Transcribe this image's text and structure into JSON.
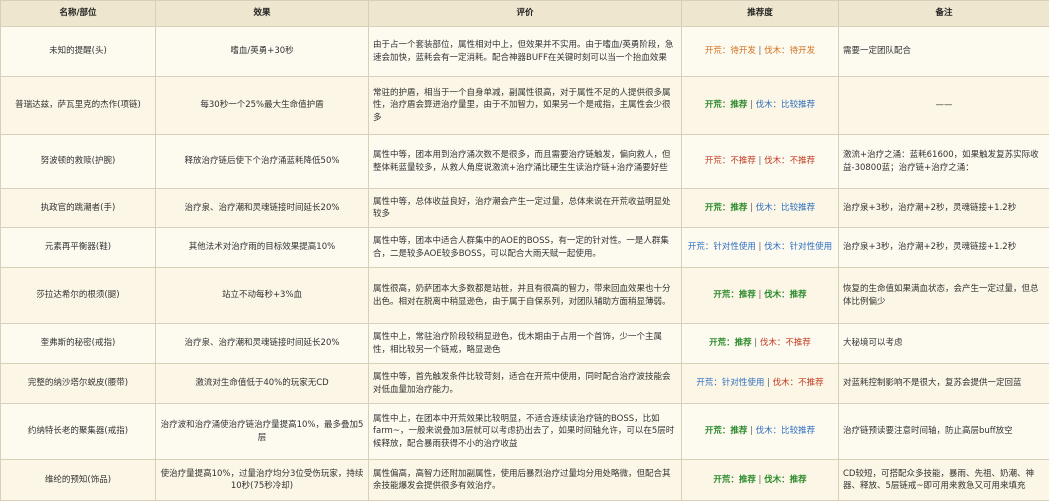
{
  "headers": {
    "name": "名称/部位",
    "effect": "效果",
    "review": "评价",
    "rec": "推荐度",
    "note": "备注"
  },
  "colors": {
    "recommend": "#2e8b2e",
    "notRecommend": "#c23b22",
    "pending": "#d0711d",
    "situational": "#2f6fbf"
  },
  "rows": [
    {
      "name": "未知的提醒(头)",
      "effect": "嗜血/英勇+30秒",
      "review": "由于占一个套装部位，属性相对中上，但效果并不实用。由于嗜血/英勇阶段，急速会加快，蓝耗会有一定消耗。配合神器BUFF在关键时刻可以当一个抬血效果",
      "rec": {
        "a": "开荒：待开发",
        "b": "伐木：待开发"
      },
      "note": "需要一定团队配合"
    },
    {
      "name": "普瑞达兹，萨瓦里克的杰作(项链)",
      "effect": "每30秒一个25%最大生命值护盾",
      "review": "常驻的护盾，相当于一个自身单减，副属性很高，对于属性不足的人提供很多属性，治疗盾会算进治疗量里，由于不加智力，如果另一个是戒指，主属性会少很多",
      "rec": {
        "a": "开荒：推荐",
        "b": "伐木：比较推荐"
      },
      "note": "——"
    },
    {
      "name": "努波顿的救赎(护腕)",
      "effect": "释放治疗链后使下个治疗涌蓝耗降低50%",
      "review": "属性中等，团本用到治疗涌次数不是很多，而且需要治疗链触发，偏向救人，但整体耗蓝量较多，从救人角度说激流+治疗涌比硬生生读治疗链+治疗涌要好些",
      "rec": {
        "a": "开荒：不推荐",
        "b": "伐木：不推荐"
      },
      "note": "激流+治疗之涌：蓝耗61600，如果触发复苏实际收益-30800蓝；治疗链+治疗之涌："
    },
    {
      "name": "执政官的跳潮者(手)",
      "effect": "治疗泉、治疗潮和灵魂链接时间延长20%",
      "review": "属性中等，总体收益良好，治疗潮会产生一定过量，总体来说在开荒收益明显处较多",
      "rec": {
        "a": "开荒：推荐",
        "b": "伐木：比较推荐"
      },
      "note": "治疗泉+3秒，治疗潮+2秒，灵魂链接+1.2秒"
    },
    {
      "name": "元素再平衡器(鞋)",
      "effect": "其他法术对治疗雨的目标效果提高10%",
      "review": "属性中等，团本中适合人群集中的AOE的BOSS，有一定的针对性。一是人群集合，二是较多AOE较多BOSS，可以配合大雨天赋一起使用。",
      "rec": {
        "a": "开荒：针对性使用",
        "b": "伐木：针对性使用"
      },
      "note": "治疗泉+3秒，治疗潮+2秒，灵魂链接+1.2秒"
    },
    {
      "name": "莎拉达希尔的根须(腿)",
      "effect": "站立不动每秒+3%血",
      "review": "属性很高，奶萨团本大多数都是站桩，并且有很高的智力，带来回血效果也十分出色。相对在脱离中稍显逊色，由于属于自保系列，对团队辅助方面稍显薄弱。",
      "rec": {
        "a": "开荒：推荐",
        "b": "伐木：推荐"
      },
      "note": "恢复的生命值如果满血状态，会产生一定过量，但总体比例偏少"
    },
    {
      "name": "奎弗斯的秘密(戒指)",
      "effect": "治疗泉、治疗潮和灵魂链接时间延长20%",
      "review": "属性中上，常驻治疗阶段较稍显逊色，伐木期由于占用一个首饰，少一个主属性，相比较另一个链戒，略显逊色",
      "rec": {
        "a": "开荒：推荐",
        "b": "伐木：不推荐"
      },
      "note": "大秘境可以考虑"
    },
    {
      "name": "完整的纳沙塔尔蜕皮(腰带)",
      "effect": "激流对生命值低于40%的玩家无CD",
      "review": "属性中等，首先触发条件比较苛刻，适合在开荒中使用，同时配合治疗波技能会对低血量加治疗能力。",
      "rec": {
        "a": "开荒：针对性使用",
        "b": "伐木：不推荐"
      },
      "note": "对蓝耗控制影响不是很大，复苏会提供一定回蓝"
    },
    {
      "name": "约纳特长老的聚集器(戒指)",
      "effect": "治疗波和治疗涌使治疗链治疗量提高10%，最多叠加5层",
      "review": "属性中上，在团本中开荒效果比较明显，不适合连续读治疗链的BOSS，比如farm~，一般来说叠加3层就可以考虑扔出去了，如果时间轴允许，可以在5层时候释放，配合暴雨获得不小的治疗收益",
      "rec": {
        "a": "开荒：推荐",
        "b": "伐木：比较推荐"
      },
      "note": "治疗链预读要注意时间轴，防止高层buff放空"
    },
    {
      "name": "维纶的预知(饰品)",
      "effect": "使治疗量提高10%，过量治疗均分3位受伤玩家，持续10秒(75秒冷却)",
      "review": "属性偏高，高智力还附加副属性，使用后暴烈治疗过量均分用处略微，但配合其余技能爆发会提供很多有效治疗。",
      "rec": {
        "a": "开荒：推荐",
        "b": "伐木：推荐"
      },
      "note": "CD较短，可搭配众多技能，暴雨、先祖、奶潮、神器、释放、5层链戒~即可用来救急又可用来填充"
    }
  ]
}
